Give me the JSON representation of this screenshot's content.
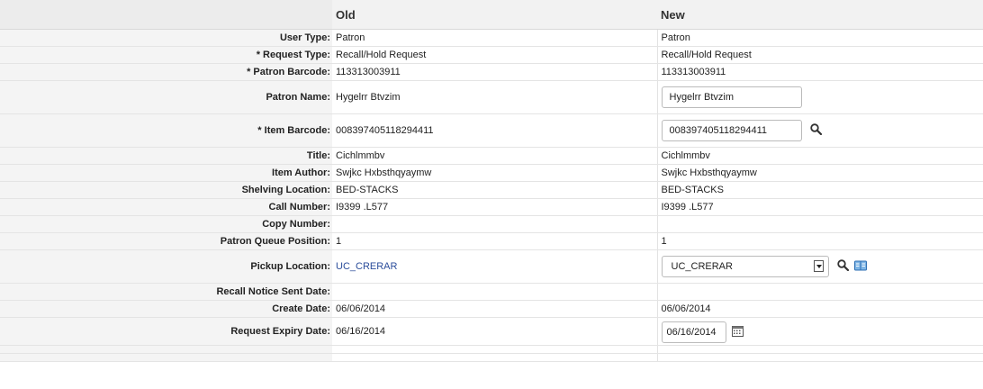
{
  "headers": {
    "label": "",
    "old": "Old",
    "new": "New"
  },
  "rows": [
    {
      "label": "User Type:",
      "old": "Patron",
      "new": "Patron"
    },
    {
      "label": "* Request Type:",
      "old": "Recall/Hold Request",
      "new": "Recall/Hold Request"
    },
    {
      "label": "* Patron Barcode:",
      "old": "113313003911",
      "new": "113313003911"
    },
    {
      "label": "Patron Name:",
      "old": "Hygelrr Btvzim",
      "new": "Hygelrr Btvzim"
    },
    {
      "label": "* Item Barcode:",
      "old": "008397405118294411",
      "new": "008397405118294411"
    },
    {
      "label": "Title:",
      "old": "Cichlmmbv",
      "new": "Cichlmmbv"
    },
    {
      "label": "Item Author:",
      "old": "Swjkc Hxbsthqyaymw",
      "new": "Swjkc Hxbsthqyaymw"
    },
    {
      "label": "Shelving Location:",
      "old": "BED-STACKS",
      "new": "BED-STACKS"
    },
    {
      "label": "Call Number:",
      "old": "I9399 .L577",
      "new": "I9399 .L577"
    },
    {
      "label": "Copy Number:",
      "old": "",
      "new": ""
    },
    {
      "label": "Patron Queue Position:",
      "old": "1",
      "new": "1"
    },
    {
      "label": "Pickup Location:",
      "old": "UC_CRERAR",
      "new": "UC_CRERAR"
    },
    {
      "label": "Recall Notice Sent Date:",
      "old": "",
      "new": ""
    },
    {
      "label": "Create Date:",
      "old": "06/06/2014",
      "new": "06/06/2014"
    },
    {
      "label": "Request Expiry Date:",
      "old": "06/16/2014",
      "new": "06/16/2014"
    }
  ],
  "icons": {
    "search": "search-icon",
    "book": "book-icon",
    "calendar": "calendar-icon",
    "dropdown": "chevron-down-icon"
  },
  "colors": {
    "link": "#2b4d9b",
    "header_bg": "#f2f2f2",
    "label_bg": "#f4f4f4"
  }
}
